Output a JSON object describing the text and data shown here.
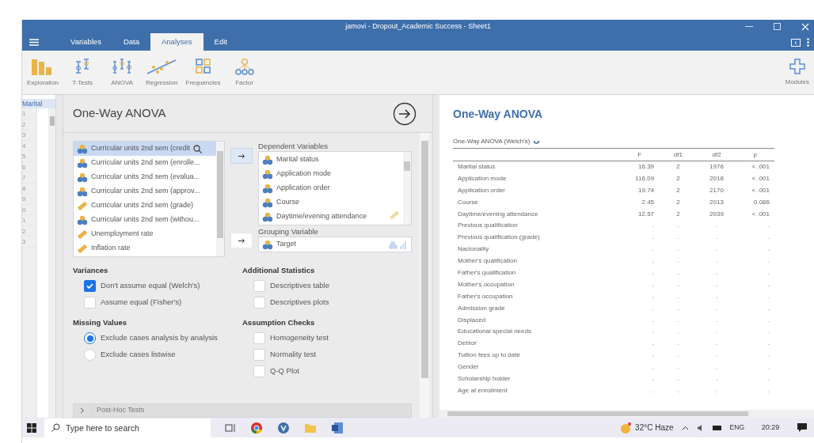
{
  "window": {
    "title": "jamovi - Dropout_Academic Success - Sheet1"
  },
  "tabs": [
    {
      "label": "Variables",
      "selected": false
    },
    {
      "label": "Data",
      "selected": false
    },
    {
      "label": "Analyses",
      "selected": true
    },
    {
      "label": "Edit",
      "selected": false
    }
  ],
  "toolbar": [
    {
      "label": "Exploration",
      "kind": "exploration"
    },
    {
      "label": "T-Tests",
      "kind": "ttests"
    },
    {
      "label": "ANOVA",
      "kind": "anova"
    },
    {
      "label": "Regression",
      "kind": "regression"
    },
    {
      "label": "Frequencies",
      "kind": "frequencies"
    },
    {
      "label": "Factor",
      "kind": "factor"
    }
  ],
  "modules": {
    "label": "Modules"
  },
  "spreadsheet": {
    "column": "Marital",
    "rows": [
      "1",
      "2",
      "3",
      "4",
      "5",
      "6",
      "7",
      "8",
      "9",
      "0",
      "1",
      "2",
      "3"
    ]
  },
  "options": {
    "title": "One-Way ANOVA",
    "variables": [
      {
        "name": "Curricular units 2nd sem (credit",
        "kind": "nominal",
        "selected": true
      },
      {
        "name": "Curricular units 2nd sem (enrolle...",
        "kind": "nominal",
        "selected": false
      },
      {
        "name": "Curricular units 2nd sem (evalua...",
        "kind": "nominal",
        "selected": false
      },
      {
        "name": "Curricular units 2nd sem (approv...",
        "kind": "nominal",
        "selected": false
      },
      {
        "name": "Curricular units 2nd sem (grade)",
        "kind": "continuous",
        "selected": false
      },
      {
        "name": "Curricular units 2nd sem (withou...",
        "kind": "nominal",
        "selected": false
      },
      {
        "name": "Unemployment rate",
        "kind": "continuous",
        "selected": false
      },
      {
        "name": "Inflation rate",
        "kind": "continuous",
        "selected": false
      }
    ],
    "dependent": {
      "label": "Dependent Variables",
      "items": [
        "Marital status",
        "Application mode",
        "Application order",
        "Course",
        "Daytime/evening attendance"
      ]
    },
    "grouping": {
      "label": "Grouping Variable",
      "item": "Target"
    },
    "sections": [
      {
        "title": "Variances",
        "items": [
          {
            "kind": "checkbox",
            "label": "Don't assume equal (Welch's)",
            "checked": true
          },
          {
            "kind": "checkbox",
            "label": "Assume equal (Fisher's)",
            "checked": false
          }
        ]
      },
      {
        "title": "Additional Statistics",
        "items": [
          {
            "kind": "checkbox",
            "label": "Descriptives table",
            "checked": false
          },
          {
            "kind": "checkbox",
            "label": "Descriptives plots",
            "checked": false
          }
        ]
      },
      {
        "title": "Missing Values",
        "items": [
          {
            "kind": "radio",
            "label": "Exclude cases analysis by analysis",
            "checked": true
          },
          {
            "kind": "radio",
            "label": "Exclude cases listwise",
            "checked": false
          }
        ]
      },
      {
        "title": "Assumption Checks",
        "items": [
          {
            "kind": "checkbox",
            "label": "Homogeneity test",
            "checked": false
          },
          {
            "kind": "checkbox",
            "label": "Normality test",
            "checked": false
          },
          {
            "kind": "checkbox",
            "label": "Q-Q Plot",
            "checked": false
          }
        ]
      }
    ],
    "collapsed": [
      {
        "label": "Post-Hoc Tests",
        "expanded": false
      }
    ]
  },
  "results": {
    "title": "One-Way ANOVA",
    "table_title": "One-Way ANOVA (Welch's)",
    "columns": [
      "F",
      "df1",
      "df2",
      "p"
    ],
    "rows": [
      {
        "name": "Marital status",
        "values": [
          "16.39",
          "2",
          "1976",
          "< .001"
        ]
      },
      {
        "name": "Application mode",
        "values": [
          "116.09",
          "2",
          "2018",
          "< .001"
        ]
      },
      {
        "name": "Application order",
        "values": [
          "19.74",
          "2",
          "2170",
          "< .001"
        ]
      },
      {
        "name": "Course",
        "values": [
          "2.45",
          "2",
          "2013",
          "0.086"
        ]
      },
      {
        "name": "Daytime/evening attendance",
        "values": [
          "12.57",
          "2",
          "2039",
          "< .001"
        ]
      },
      {
        "name": "Previous qualification",
        "values": [
          ".",
          ".",
          ".",
          "."
        ]
      },
      {
        "name": "Previous qualification (grade)",
        "values": [
          ".",
          ".",
          ".",
          "."
        ]
      },
      {
        "name": "Nacionality",
        "values": [
          ".",
          ".",
          ".",
          "."
        ]
      },
      {
        "name": "Mother's qualification",
        "values": [
          ".",
          ".",
          ".",
          "."
        ]
      },
      {
        "name": "Father's qualification",
        "values": [
          ".",
          ".",
          ".",
          "."
        ]
      },
      {
        "name": "Mother's occupation",
        "values": [
          ".",
          ".",
          ".",
          "."
        ]
      },
      {
        "name": "Father's occupation",
        "values": [
          ".",
          ".",
          ".",
          "."
        ]
      },
      {
        "name": "Admission grade",
        "values": [
          ".",
          ".",
          ".",
          "."
        ]
      },
      {
        "name": "Displaced",
        "values": [
          ".",
          ".",
          ".",
          "."
        ]
      },
      {
        "name": "Educational special needs",
        "values": [
          ".",
          ".",
          ".",
          "."
        ]
      },
      {
        "name": "Debtor",
        "values": [
          ".",
          ".",
          ".",
          "."
        ]
      },
      {
        "name": "Tuition fees up to date",
        "values": [
          ".",
          ".",
          ".",
          "."
        ]
      },
      {
        "name": "Gender",
        "values": [
          ".",
          ".",
          ".",
          "."
        ]
      },
      {
        "name": "Scholarship holder",
        "values": [
          ".",
          ".",
          ".",
          "."
        ]
      },
      {
        "name": "Age at enrollment",
        "values": [
          ".",
          ".",
          ".",
          "."
        ]
      }
    ]
  },
  "taskbar": {
    "search_placeholder": "Type here to search",
    "weather": "32°C Haze",
    "language": "ENG",
    "time": "20:29"
  }
}
